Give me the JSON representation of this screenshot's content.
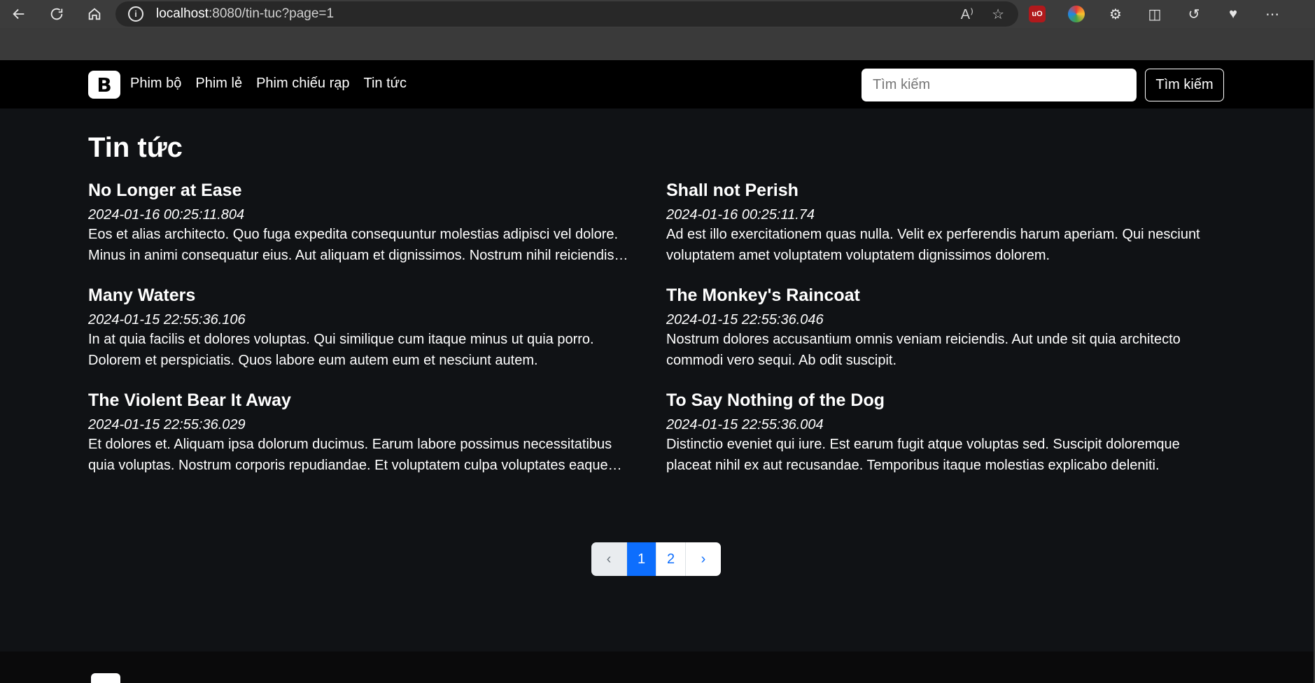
{
  "browser": {
    "url_host": "localhost",
    "url_rest": ":8080/tin-tuc?page=1"
  },
  "navbar": {
    "brand": "B",
    "links": [
      "Phim bộ",
      "Phim lẻ",
      "Phim chiếu rạp",
      "Tin tức"
    ],
    "search_placeholder": "Tìm kiếm",
    "search_button": "Tìm kiếm"
  },
  "main": {
    "title": "Tin tức",
    "posts": [
      {
        "title": "No Longer at Ease",
        "date": "2024-01-16 00:25:11.804",
        "body": "Eos et alias architecto. Quo fuga expedita consequuntur molestias adipisci vel dolore. Minus in animi consequatur eius. Aut aliquam et dignissimos. Nostrum nihil reiciendis quidem."
      },
      {
        "title": "Shall not Perish",
        "date": "2024-01-16 00:25:11.74",
        "body": "Ad est illo exercitationem quas nulla. Velit ex perferendis harum aperiam. Qui nesciunt voluptatem amet voluptatem voluptatem dignissimos dolorem."
      },
      {
        "title": "Many Waters",
        "date": "2024-01-15 22:55:36.106",
        "body": "In at quia facilis et dolores voluptas. Qui similique cum itaque minus ut quia porro. Dolorem et perspiciatis. Quos labore eum autem eum et nesciunt autem."
      },
      {
        "title": "The Monkey's Raincoat",
        "date": "2024-01-15 22:55:36.046",
        "body": "Nostrum dolores accusantium omnis veniam reiciendis. Aut unde sit quia architecto commodi vero sequi. Ab odit suscipit."
      },
      {
        "title": "The Violent Bear It Away",
        "date": "2024-01-15 22:55:36.029",
        "body": "Et dolores et. Aliquam ipsa dolorum ducimus. Earum labore possimus necessitatibus quia voluptas. Nostrum corporis repudiandae. Et voluptatem culpa voluptates eaque quia."
      },
      {
        "title": "To Say Nothing of the Dog",
        "date": "2024-01-15 22:55:36.004",
        "body": "Distinctio eveniet qui iure. Est earum fugit atque voluptas sed. Suscipit doloremque placeat nihil ex aut recusandae. Temporibus itaque molestias explicabo deleniti."
      }
    ]
  },
  "pagination": {
    "prev": "‹",
    "pages": [
      "1",
      "2"
    ],
    "active": "1",
    "next": "›"
  },
  "colors": {
    "page_bg": "#101215",
    "navbar_bg": "#000000",
    "primary": "#0d6efd"
  }
}
